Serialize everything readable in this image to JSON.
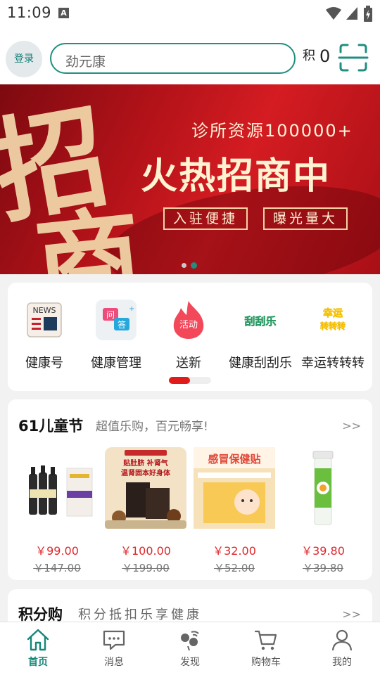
{
  "status_bar": {
    "time": "11:09",
    "notification_icon": "A"
  },
  "header": {
    "login_label": "登录",
    "search_placeholder": "劲元康",
    "points_icon": "分",
    "points_value": "0",
    "scan_icon": "scan-icon"
  },
  "banner": {
    "big_text_1": "招",
    "big_text_2": "商",
    "subtitle": "诊所资源100000+",
    "title": "火热招商中",
    "tag_1": "入驻便捷",
    "tag_2": "曝光量大",
    "slide_count": 2,
    "active_slide": 2
  },
  "quick_menu": {
    "items": [
      {
        "label": "健康号",
        "icon": "news-icon",
        "icon_text": "NEWS"
      },
      {
        "label": "健康管理",
        "icon": "qa-icon",
        "icon_text_q": "问",
        "icon_text_a": "答"
      },
      {
        "label": "送新",
        "icon": "activity-flame-icon",
        "icon_text": "活动"
      },
      {
        "label": "健康刮刮乐",
        "icon": "scratch-card-icon",
        "icon_text": "刮刮乐"
      },
      {
        "label": "幸运转转转",
        "icon": "lucky-wheel-icon",
        "icon_text": "幸运转转转"
      }
    ],
    "page_count": 2,
    "active_page": 1
  },
  "promo": {
    "title": "61儿童节",
    "subtitle": "超值乐购，百元畅享!",
    "more": ">>",
    "products": [
      {
        "price": "￥99.00",
        "original_price": "￥147.00"
      },
      {
        "price": "￥100.00",
        "original_price": "￥199.00",
        "badge": "贴肚脐 补肾气",
        "badge2": "温肾固本好身体"
      },
      {
        "price": "￥32.00",
        "original_price": "￥52.00",
        "badge": "感冒保健贴"
      },
      {
        "price": "￥39.80",
        "original_price": "￥39.80"
      }
    ]
  },
  "points_shop": {
    "title": "积分购",
    "subtitle": "积分抵扣乐享健康",
    "more": ">>"
  },
  "tab_bar": {
    "tabs": [
      {
        "label": "首页",
        "icon": "home-icon",
        "active": true
      },
      {
        "label": "消息",
        "icon": "message-icon",
        "active": false
      },
      {
        "label": "发现",
        "icon": "discover-icon",
        "active": false
      },
      {
        "label": "购物车",
        "icon": "cart-icon",
        "active": false
      },
      {
        "label": "我的",
        "icon": "profile-icon",
        "active": false
      }
    ]
  },
  "colors": {
    "brand_green": "#1e8f80",
    "price_red": "#e0272b",
    "banner_red": "#c8161d"
  }
}
